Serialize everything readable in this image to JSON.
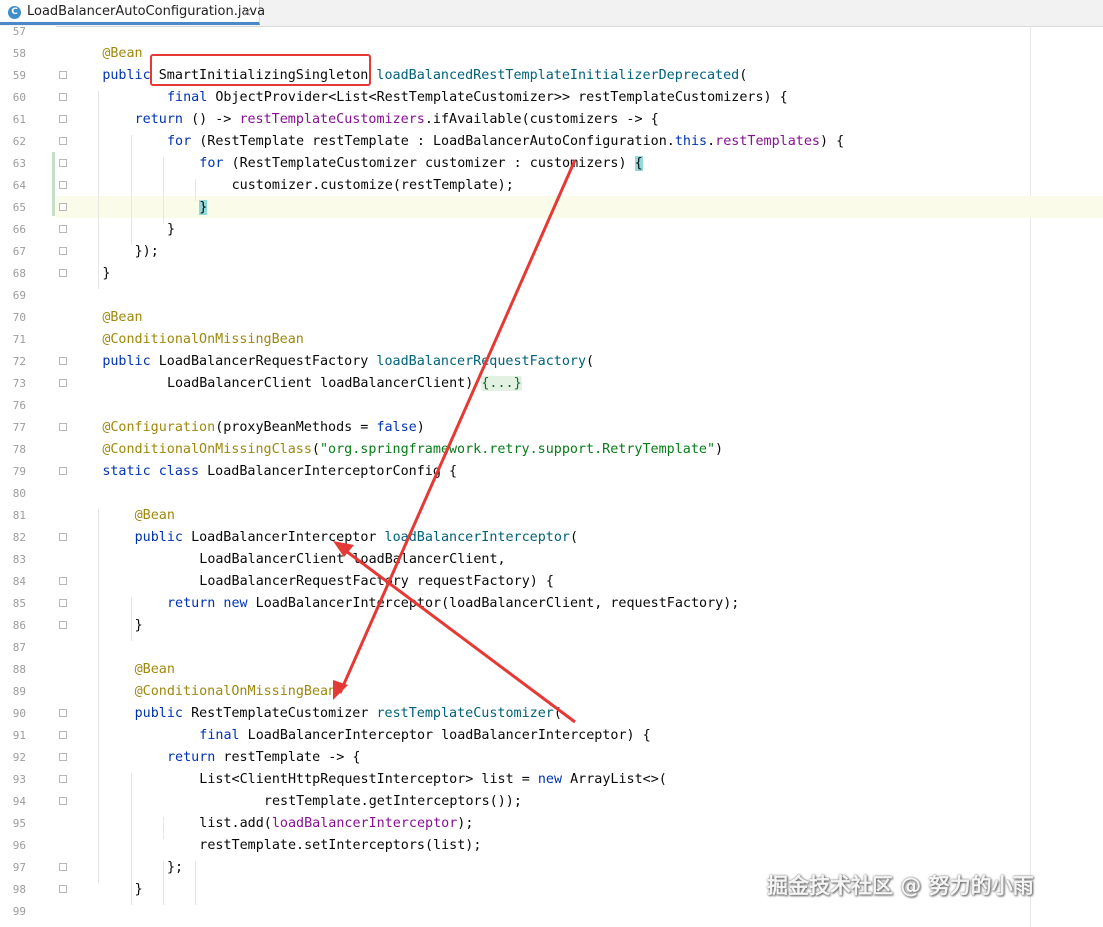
{
  "tab": {
    "icon_letter": "C",
    "title": "LoadBalancerAutoConfiguration.java",
    "close": "×"
  },
  "lines": [
    {
      "n": "57",
      "segs": []
    },
    {
      "n": "58",
      "segs": [
        {
          "t": "@Bean",
          "c": "a",
          "ind": 4
        }
      ]
    },
    {
      "n": "59",
      "segs": [
        {
          "t": "public ",
          "c": "k",
          "ind": 4
        },
        {
          "t": "SmartInitializingSingleton ",
          "c": ""
        },
        {
          "t": "loadBalancedRestTemplateInitializerDeprecated",
          "c": "m"
        },
        {
          "t": "(",
          "c": ""
        }
      ]
    },
    {
      "n": "60",
      "segs": [
        {
          "t": "final ",
          "c": "k",
          "ind": 12
        },
        {
          "t": "ObjectProvider<List<RestTemplateCustomizer>> restTemplateCustomizers) {",
          "c": ""
        }
      ]
    },
    {
      "n": "61",
      "segs": [
        {
          "t": "return ",
          "c": "k",
          "ind": 8
        },
        {
          "t": "() -> ",
          "c": ""
        },
        {
          "t": "restTemplateCustomizers",
          "c": "f"
        },
        {
          "t": ".ifAvailable(customizers -> {",
          "c": ""
        }
      ]
    },
    {
      "n": "62",
      "segs": [
        {
          "t": "for ",
          "c": "k",
          "ind": 12
        },
        {
          "t": "(RestTemplate restTemplate : LoadBalancerAutoConfiguration.",
          "c": ""
        },
        {
          "t": "this",
          "c": "k"
        },
        {
          "t": ".",
          "c": ""
        },
        {
          "t": "restTemplates",
          "c": "f"
        },
        {
          "t": ") {",
          "c": ""
        }
      ]
    },
    {
      "n": "63",
      "segs": [
        {
          "t": "for ",
          "c": "k",
          "ind": 16
        },
        {
          "t": "(RestTemplateCustomizer customizer : customizers) ",
          "c": ""
        },
        {
          "t": "{",
          "c": "hl"
        }
      ]
    },
    {
      "n": "64",
      "segs": [
        {
          "t": "customizer.customize(restTemplate);",
          "c": "",
          "ind": 20
        }
      ]
    },
    {
      "n": "65",
      "segs": [
        {
          "t": "}",
          "c": "hl",
          "ind": 16
        }
      ]
    },
    {
      "n": "66",
      "segs": [
        {
          "t": "}",
          "c": "",
          "ind": 12
        }
      ]
    },
    {
      "n": "67",
      "segs": [
        {
          "t": "});",
          "c": "",
          "ind": 8
        }
      ]
    },
    {
      "n": "68",
      "segs": [
        {
          "t": "}",
          "c": "",
          "ind": 4
        }
      ]
    },
    {
      "n": "69",
      "segs": []
    },
    {
      "n": "70",
      "segs": [
        {
          "t": "@Bean",
          "c": "a",
          "ind": 4
        }
      ]
    },
    {
      "n": "71",
      "segs": [
        {
          "t": "@ConditionalOnMissingBean",
          "c": "a",
          "ind": 4
        }
      ]
    },
    {
      "n": "72",
      "segs": [
        {
          "t": "public ",
          "c": "k",
          "ind": 4
        },
        {
          "t": "LoadBalancerRequestFactory ",
          "c": ""
        },
        {
          "t": "loadBalancerRequestFactory",
          "c": "m"
        },
        {
          "t": "(",
          "c": ""
        }
      ]
    },
    {
      "n": "73",
      "segs": [
        {
          "t": "LoadBalancerClient loadBalancerClient) ",
          "c": "",
          "ind": 12
        },
        {
          "t": "{...}",
          "c": "foldbox"
        }
      ]
    },
    {
      "n": "76",
      "segs": []
    },
    {
      "n": "77",
      "segs": [
        {
          "t": "@Configuration",
          "c": "a",
          "ind": 4
        },
        {
          "t": "(proxyBeanMethods = ",
          "c": ""
        },
        {
          "t": "false",
          "c": "k"
        },
        {
          "t": ")",
          "c": ""
        }
      ]
    },
    {
      "n": "78",
      "segs": [
        {
          "t": "@ConditionalOnMissingClass",
          "c": "a",
          "ind": 4
        },
        {
          "t": "(",
          "c": ""
        },
        {
          "t": "\"org.springframework.retry.support.RetryTemplate\"",
          "c": "s"
        },
        {
          "t": ")",
          "c": ""
        }
      ]
    },
    {
      "n": "79",
      "segs": [
        {
          "t": "static class ",
          "c": "k",
          "ind": 4
        },
        {
          "t": "LoadBalancerInterceptorConfig {",
          "c": ""
        }
      ]
    },
    {
      "n": "80",
      "segs": []
    },
    {
      "n": "81",
      "segs": [
        {
          "t": "@Bean",
          "c": "a",
          "ind": 8
        }
      ]
    },
    {
      "n": "82",
      "segs": [
        {
          "t": "public ",
          "c": "k",
          "ind": 8
        },
        {
          "t": "LoadBalancerInterceptor ",
          "c": ""
        },
        {
          "t": "loadBalancerInterceptor",
          "c": "m"
        },
        {
          "t": "(",
          "c": ""
        }
      ]
    },
    {
      "n": "83",
      "segs": [
        {
          "t": "LoadBalancerClient loadBalancerClient,",
          "c": "",
          "ind": 16
        }
      ]
    },
    {
      "n": "84",
      "segs": [
        {
          "t": "LoadBalancerRequestFactory requestFactory) {",
          "c": "",
          "ind": 16
        }
      ]
    },
    {
      "n": "85",
      "segs": [
        {
          "t": "return new ",
          "c": "k",
          "ind": 12
        },
        {
          "t": "LoadBalancerInterceptor(loadBalancerClient, requestFactory);",
          "c": ""
        }
      ]
    },
    {
      "n": "86",
      "segs": [
        {
          "t": "}",
          "c": "",
          "ind": 8
        }
      ]
    },
    {
      "n": "87",
      "segs": []
    },
    {
      "n": "88",
      "segs": [
        {
          "t": "@Bean",
          "c": "a",
          "ind": 8
        }
      ]
    },
    {
      "n": "89",
      "segs": [
        {
          "t": "@ConditionalOnMissingBean",
          "c": "a",
          "ind": 8
        }
      ]
    },
    {
      "n": "90",
      "segs": [
        {
          "t": "public ",
          "c": "k",
          "ind": 8
        },
        {
          "t": "RestTemplateCustomizer ",
          "c": ""
        },
        {
          "t": "restTemplateCustomizer",
          "c": "m"
        },
        {
          "t": "(",
          "c": ""
        }
      ]
    },
    {
      "n": "91",
      "segs": [
        {
          "t": "final ",
          "c": "k",
          "ind": 16
        },
        {
          "t": "LoadBalancerInterceptor loadBalancerInterceptor) {",
          "c": ""
        }
      ]
    },
    {
      "n": "92",
      "segs": [
        {
          "t": "return ",
          "c": "k",
          "ind": 12
        },
        {
          "t": "restTemplate -> {",
          "c": ""
        }
      ]
    },
    {
      "n": "93",
      "segs": [
        {
          "t": "List<ClientHttpRequestInterceptor> list = ",
          "c": "",
          "ind": 16
        },
        {
          "t": "new ",
          "c": "k"
        },
        {
          "t": "ArrayList<>(",
          "c": ""
        }
      ]
    },
    {
      "n": "94",
      "segs": [
        {
          "t": "restTemplate.getInterceptors());",
          "c": "",
          "ind": 24
        }
      ]
    },
    {
      "n": "95",
      "segs": [
        {
          "t": "list.add(",
          "c": "",
          "ind": 16
        },
        {
          "t": "loadBalancerInterceptor",
          "c": "f"
        },
        {
          "t": ");",
          "c": ""
        }
      ]
    },
    {
      "n": "96",
      "segs": [
        {
          "t": "restTemplate.setInterceptors(list);",
          "c": "",
          "ind": 16
        }
      ]
    },
    {
      "n": "97",
      "segs": [
        {
          "t": "};",
          "c": "",
          "ind": 12
        }
      ]
    },
    {
      "n": "98",
      "segs": [
        {
          "t": "}",
          "c": "",
          "ind": 8
        }
      ]
    },
    {
      "n": "99",
      "segs": []
    }
  ],
  "fold_markers": [
    "59",
    "60",
    "61",
    "62",
    "63",
    "64",
    "65",
    "66",
    "67",
    "68",
    "72",
    "73",
    "77",
    "79",
    "82",
    "84",
    "85",
    "86",
    "90",
    "91",
    "92",
    "93",
    "94",
    "97",
    "98"
  ],
  "watermark": "掘金技术社区 @ 努力的小雨",
  "colors": {
    "keyword": "#0033b3",
    "annotation": "#9e880d",
    "method": "#00627a",
    "field": "#871094",
    "string": "#067d17",
    "annotation_red": "#e53935"
  }
}
